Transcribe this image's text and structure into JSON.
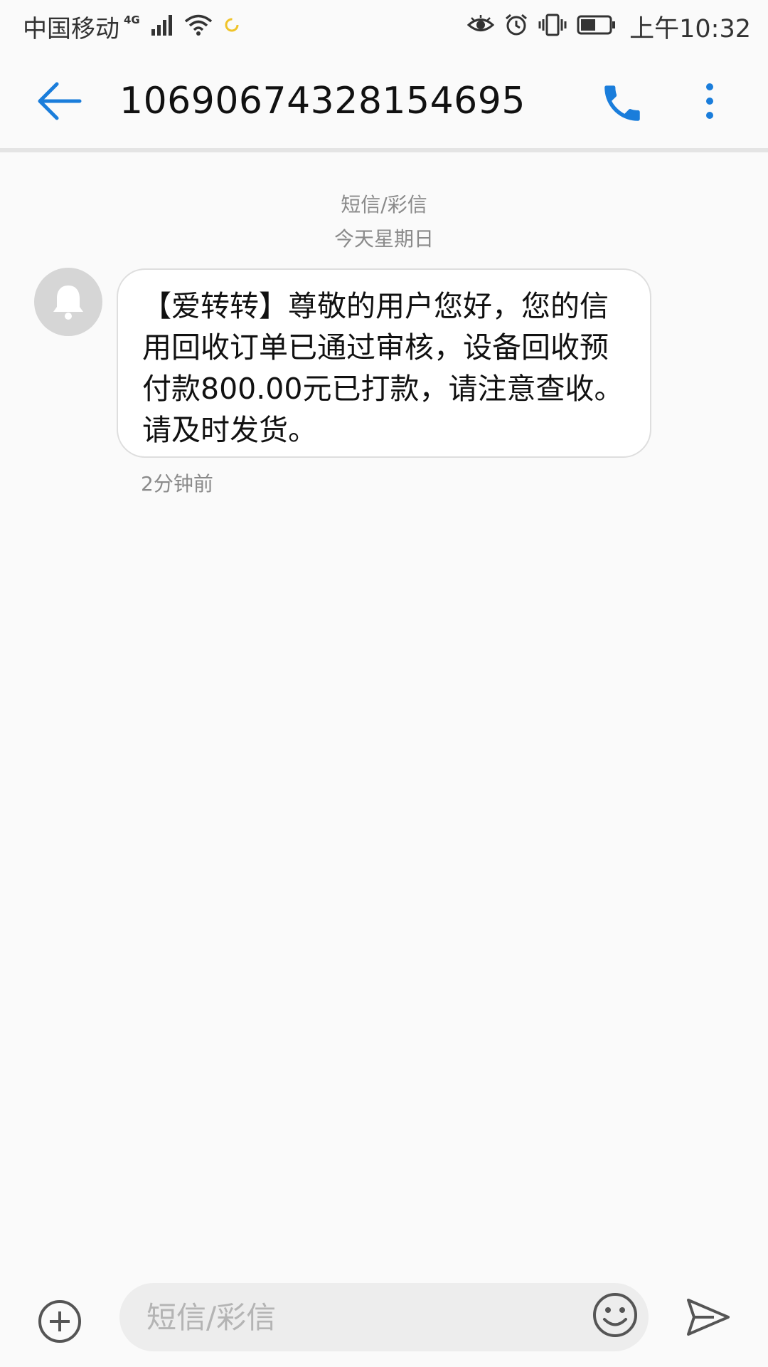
{
  "status_bar": {
    "carrier": "中国移动",
    "network": "4G",
    "time": "上午10:32",
    "icons": [
      "signal-icon",
      "wifi-icon",
      "sync-icon",
      "eye-icon",
      "alarm-icon",
      "vibrate-icon",
      "battery-icon"
    ]
  },
  "header": {
    "title": "10690674328154695",
    "icons": [
      "back-arrow-icon",
      "phone-icon",
      "more-vert-icon"
    ]
  },
  "conversation": {
    "channel_label": "短信/彩信",
    "date_label": "今天星期日",
    "messages": [
      {
        "text": "【爱转转】尊敬的用户您好，您的信用回收订单已通过审核，设备回收预付款800.00元已打款，请注意查收。请及时发货。",
        "time": "2分钟前",
        "avatar_icon": "bell-icon"
      }
    ]
  },
  "composer": {
    "placeholder": "短信/彩信",
    "icons": [
      "add-circle-icon",
      "emoji-icon",
      "send-icon"
    ]
  },
  "colors": {
    "accent": "#1a7ddb",
    "background": "#fafafa",
    "bubble_border": "#dedede",
    "meta_text": "#8a8a8a"
  }
}
